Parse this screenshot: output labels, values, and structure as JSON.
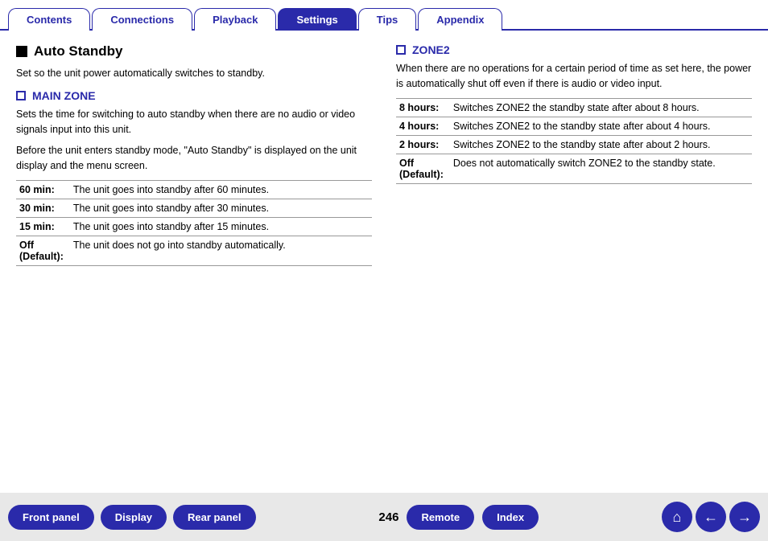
{
  "tabs": [
    {
      "label": "Contents",
      "active": false
    },
    {
      "label": "Connections",
      "active": false
    },
    {
      "label": "Playback",
      "active": false
    },
    {
      "label": "Settings",
      "active": true
    },
    {
      "label": "Tips",
      "active": false
    },
    {
      "label": "Appendix",
      "active": false
    }
  ],
  "left": {
    "section_title": "Auto Standby",
    "section_desc": "Set so the unit power automatically switches to standby.",
    "subsection_title": "MAIN ZONE",
    "subsection_desc1": "Sets the time for switching to auto standby when there are no audio or video signals input into this unit.",
    "subsection_desc2": "Before the unit enters standby mode, \"Auto Standby\" is displayed on the unit display and the menu screen.",
    "table_rows": [
      {
        "label": "60 min:",
        "value": "The unit goes into standby after 60 minutes."
      },
      {
        "label": "30 min:",
        "value": "The unit goes into standby after 30 minutes."
      },
      {
        "label": "15 min:",
        "value": "The unit goes into standby after 15 minutes."
      },
      {
        "label": "Off\n(Default):",
        "value": "The unit does not go into standby automatically."
      }
    ]
  },
  "right": {
    "section_title": "ZONE2",
    "section_desc": "When there are no operations for a certain period of time as set here, the power is automatically shut off even if there is audio or video input.",
    "table_rows": [
      {
        "label": "8 hours:",
        "value": "Switches ZONE2 the standby state after about 8 hours."
      },
      {
        "label": "4 hours:",
        "value": "Switches ZONE2 to the standby state after about 4 hours."
      },
      {
        "label": "2 hours:",
        "value": "Switches ZONE2 to the standby state after about 2 hours."
      },
      {
        "label": "Off\n(Default):",
        "value": "Does not automatically switch ZONE2 to the standby state."
      }
    ]
  },
  "bottom": {
    "page_number": "246",
    "buttons": [
      {
        "label": "Front panel",
        "name": "front-panel-button"
      },
      {
        "label": "Display",
        "name": "display-button"
      },
      {
        "label": "Rear panel",
        "name": "rear-panel-button"
      },
      {
        "label": "Remote",
        "name": "remote-button"
      },
      {
        "label": "Index",
        "name": "index-button"
      }
    ],
    "home_icon": "⌂",
    "back_icon": "←",
    "forward_icon": "→"
  }
}
